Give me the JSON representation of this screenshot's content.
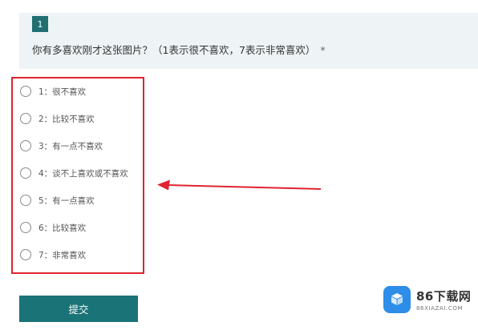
{
  "question": {
    "number": "1",
    "text": "你有多喜欢刚才这张图片？（1表示很不喜欢，7表示非常喜欢）",
    "required_mark": "*"
  },
  "options": [
    {
      "label": "1：很不喜欢",
      "selected": false
    },
    {
      "label": "2：比较不喜欢",
      "selected": false
    },
    {
      "label": "3：有一点不喜欢",
      "selected": false
    },
    {
      "label": "4：谈不上喜欢或不喜欢",
      "selected": false
    },
    {
      "label": "5：有一点喜欢",
      "selected": false
    },
    {
      "label": "6：比较喜欢",
      "selected": false
    },
    {
      "label": "7：非常喜欢",
      "selected": false
    }
  ],
  "submit": {
    "label": "提交"
  },
  "watermark": {
    "name": "86下载网",
    "domain": "86XIAZAI.COM"
  },
  "colors": {
    "header_bg": "#eef3f5",
    "accent": "#1a7377",
    "highlight_border": "#e0242f",
    "arrow": "#e0242f",
    "watermark_logo": "#2d8de8"
  },
  "icons": {
    "arrow": "red-arrow-icon",
    "logo": "box-logo-icon"
  }
}
